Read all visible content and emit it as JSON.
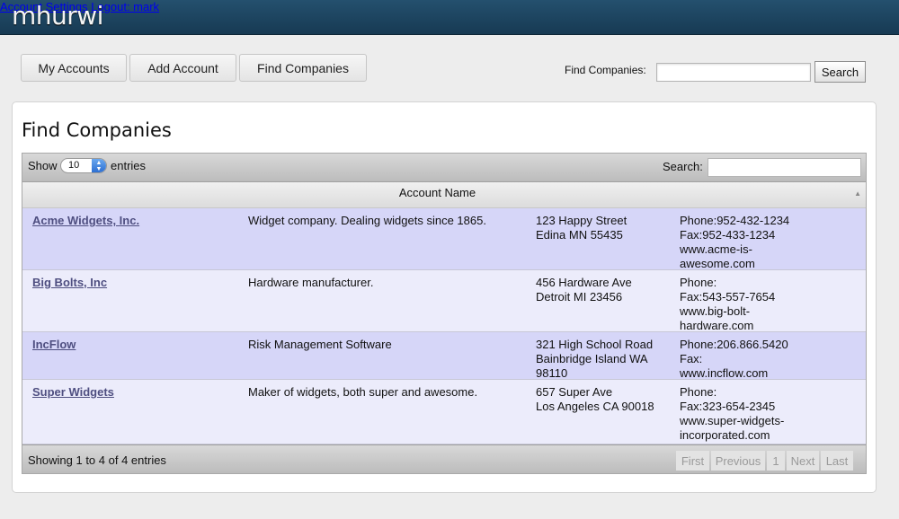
{
  "app": {
    "logo": "mhurwi"
  },
  "topnav": {
    "account_settings": "Account Settings",
    "logout": "Logout: mark"
  },
  "tabs": [
    {
      "label": "My Accounts"
    },
    {
      "label": "Add Account"
    },
    {
      "label": "Find Companies"
    }
  ],
  "header_search": {
    "label": "Find Companies:",
    "value": "",
    "button": "Search"
  },
  "page": {
    "title": "Find Companies"
  },
  "table": {
    "show_label": "Show",
    "page_size": "10",
    "entries_label": "entries",
    "search_label": "Search:",
    "search_value": "",
    "column_header": "Account Name",
    "rows": [
      {
        "name": "Acme Widgets, Inc.",
        "description": "Widget company. Dealing widgets since 1865.",
        "address": [
          "123 Happy Street",
          "Edina MN 55435"
        ],
        "contact": [
          "Phone:952-432-1234",
          "Fax:952-433-1234",
          "www.acme-is-",
          "awesome.com"
        ]
      },
      {
        "name": "Big Bolts, Inc",
        "description": "Hardware manufacturer.",
        "address": [
          "456 Hardware Ave",
          "Detroit MI 23456"
        ],
        "contact": [
          "Phone:",
          "Fax:543-557-7654",
          "www.big-bolt-",
          "hardware.com"
        ]
      },
      {
        "name": "IncFlow",
        "description": "Risk Management Software",
        "address": [
          "321 High School Road",
          "Bainbridge Island WA",
          "98110"
        ],
        "contact": [
          "Phone:206.866.5420",
          "Fax:",
          "www.incflow.com"
        ]
      },
      {
        "name": "Super Widgets",
        "description": "Maker of widgets, both super and awesome.",
        "address": [
          "657 Super Ave",
          "Los Angeles CA 90018"
        ],
        "contact": [
          "Phone:",
          "Fax:323-654-2345",
          "www.super-widgets-",
          "incorporated.com"
        ]
      }
    ],
    "info": "Showing 1 to 4 of 4 entries",
    "pagination": {
      "first": "First",
      "previous": "Previous",
      "page": "1",
      "next": "Next",
      "last": "Last"
    }
  },
  "colors": {
    "topbar": "#1c4560",
    "row_odd": "#d6d6f8",
    "row_even": "#ececfb",
    "link": "#4e4e80"
  },
  "icons": {
    "sort": "sort-asc-icon",
    "select_arrows": "select-updown-icon"
  }
}
